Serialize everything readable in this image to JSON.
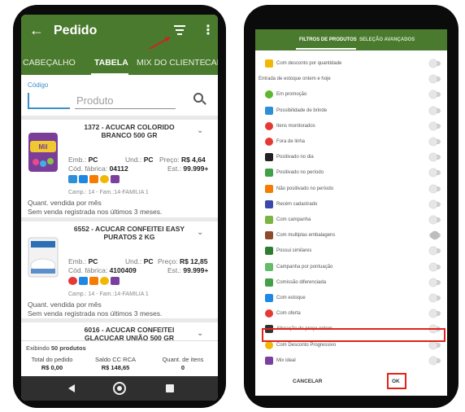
{
  "left": {
    "appbar": {
      "back_icon": "arrow-left-icon",
      "title": "Pedido",
      "filter_icon": "filter-icon",
      "more_icon": "more-vert-icon"
    },
    "tabs": [
      "CABEÇALHO",
      "TABELA",
      "MIX DO CLIENTE",
      "CAMP"
    ],
    "active_tab": "TABELA",
    "search": {
      "codigo_label": "Código",
      "produto_placeholder": "Produto"
    },
    "products": [
      {
        "name": "1372 - ACUCAR COLORIDO BRANCO 500 GR",
        "emb_label": "Emb.:",
        "emb": "PC",
        "und_label": "Und.:",
        "und": "PC",
        "preco_label": "Preço:",
        "preco": "R$ 4,64",
        "cod_label": "Cód. fábrica:",
        "cod": "04112",
        "est_label": "Est.:",
        "est": "99.999+",
        "camp": "Camp.: 14 - Fam.:14-FAMILIA 1",
        "quant": "Quant. vendida por mês",
        "sem_venda": "Sem venda registrada nos últimos 3 meses."
      },
      {
        "name": "6552 - ACUCAR CONFEITEI EASY PURATOS 2 KG",
        "emb_label": "Emb.:",
        "emb": "PC",
        "und_label": "Und.:",
        "und": "PC",
        "preco_label": "Preço:",
        "preco": "R$ 12,85",
        "cod_label": "Cód. fábrica:",
        "cod": "4100409",
        "est_label": "Est.:",
        "est": "99.999+",
        "camp": "Camp.: 14 - Fam.:14-FAMILIA 1",
        "quant": "Quant. vendida por mês",
        "sem_venda": "Sem venda registrada nos últimos 3 meses."
      },
      {
        "name": "6016 - ACUCAR CONFEITEI GLACUCAR UNIÃO 500 GR"
      }
    ],
    "footer": {
      "exibindo_prefix": "Exibindo",
      "exibindo_count": "50 produtos",
      "total_label": "Total do pedido",
      "total_value": "R$ 0,00",
      "saldo_label": "Saldo CC RCA",
      "saldo_value": "R$ 148,65",
      "quant_label": "Quant. de itens",
      "quant_value": "0"
    }
  },
  "right": {
    "tabs": [
      "FILTROS DE PRODUTOS",
      "SELEÇÃO AVANÇADOS"
    ],
    "filters": [
      {
        "label": "Com desconto por quantidade",
        "icon": "discount-bag-icon",
        "color": "#f2b705"
      },
      {
        "label": "Entrada de estoque ontem e hoje",
        "icon": "",
        "color": ""
      },
      {
        "label": "Em promoção",
        "icon": "promo-tag-icon",
        "color": "#5cb82e"
      },
      {
        "label": "Possibilidade de brinde",
        "icon": "gift-icon",
        "color": "#2f8fd6"
      },
      {
        "label": "Itens monitorados",
        "icon": "eye-icon",
        "color": "#e53935"
      },
      {
        "label": "Fora de linha",
        "icon": "warning-icon",
        "color": "#e53935"
      },
      {
        "label": "Positivado no dia",
        "icon": "cart-icon",
        "color": "#222222"
      },
      {
        "label": "Positivado no período",
        "icon": "cart-icon",
        "color": "#43a047"
      },
      {
        "label": "Não positivado no período",
        "icon": "cart-off-icon",
        "color": "#f57c00"
      },
      {
        "label": "Recém cadastrado",
        "icon": "star-icon",
        "color": "#3949ab"
      },
      {
        "label": "Com campanha",
        "icon": "tag-icon",
        "color": "#7cb342"
      },
      {
        "label": "Com multiplas embalagens",
        "icon": "boxes-icon",
        "color": "#8d4b2c"
      },
      {
        "label": "Possui similares",
        "icon": "equals-icon",
        "color": "#2e7d32"
      },
      {
        "label": "Campanha por pontuação",
        "icon": "points-icon",
        "color": "#66bb6a"
      },
      {
        "label": "Comissão diferenciada",
        "icon": "dollar-icon",
        "color": "#43a047"
      },
      {
        "label": "Com estoque",
        "icon": "stock-icon",
        "color": "#1e88e5"
      },
      {
        "label": "Com oferta",
        "icon": "offer-icon",
        "color": "#e53935"
      },
      {
        "label": "Alteração de preço ontem",
        "icon": "price-change-icon",
        "color": "#333333"
      },
      {
        "label": "Com Desconto Progressivo",
        "icon": "progressive-discount-icon",
        "color": "#f2b705"
      },
      {
        "label": "Mix ideal",
        "icon": "mix-icon",
        "color": "#7b3fa0"
      }
    ],
    "cancel_label": "CANCELAR",
    "ok_label": "OK"
  }
}
